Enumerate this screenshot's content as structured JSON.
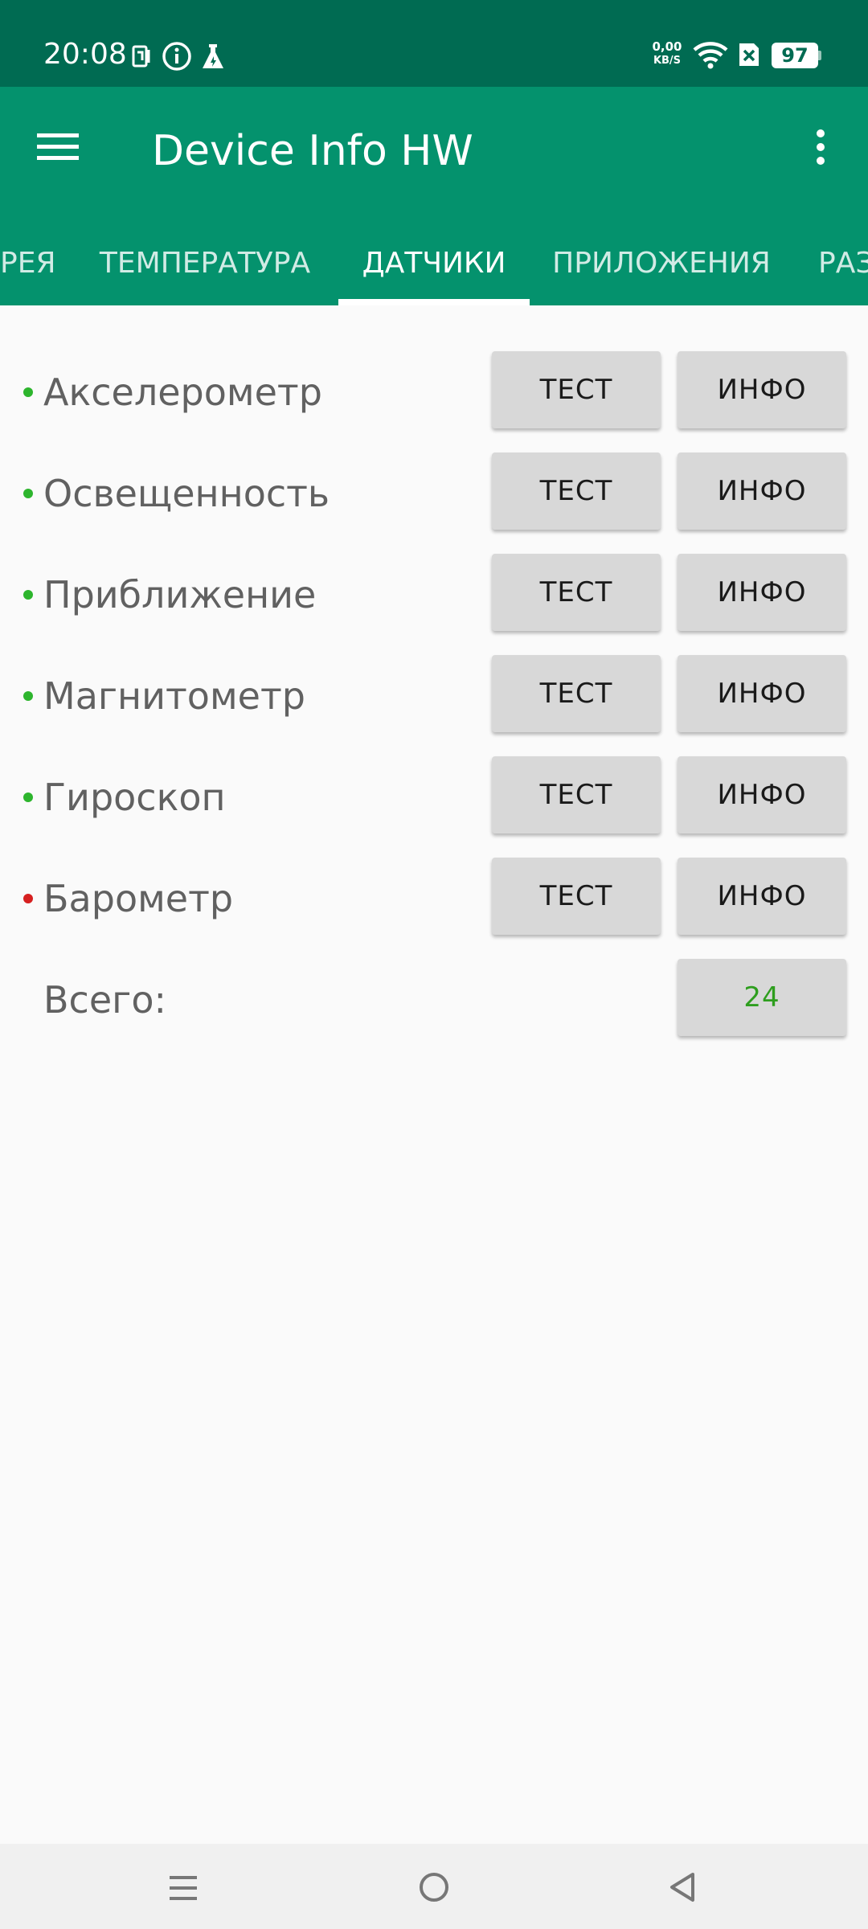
{
  "status_bar": {
    "time": "20:08",
    "net_speed_value": "0,00",
    "net_speed_unit": "KB/S",
    "battery": "97",
    "icons": [
      "nfc-icon",
      "info-icon",
      "flask-icon",
      "wifi-icon",
      "sim-off-icon",
      "battery-icon"
    ]
  },
  "app_bar": {
    "title": "Device Info HW",
    "menu_icon": "hamburger-menu-icon",
    "overflow_icon": "more-vertical-icon"
  },
  "tabs": [
    {
      "label": "РЕЯ"
    },
    {
      "label": "ТЕМПЕРАТУРА"
    },
    {
      "label": "ДАТЧИКИ",
      "active": true
    },
    {
      "label": "ПРИЛОЖЕНИЯ"
    },
    {
      "label": "РАЗ"
    }
  ],
  "sensors": [
    {
      "name": "Акселерометр",
      "status_color": "#2db52d",
      "test_label": "ТЕСТ",
      "info_label": "ИНФО"
    },
    {
      "name": "Освещенность",
      "status_color": "#2db52d",
      "test_label": "ТЕСТ",
      "info_label": "ИНФО"
    },
    {
      "name": "Приближение",
      "status_color": "#2db52d",
      "test_label": "ТЕСТ",
      "info_label": "ИНФО"
    },
    {
      "name": "Магнитометр",
      "status_color": "#2db52d",
      "test_label": "ТЕСТ",
      "info_label": "ИНФО"
    },
    {
      "name": "Гироскоп",
      "status_color": "#2db52d",
      "test_label": "ТЕСТ",
      "info_label": "ИНФО"
    },
    {
      "name": "Барометр",
      "status_color": "#d62020",
      "test_label": "ТЕСТ",
      "info_label": "ИНФО"
    }
  ],
  "total": {
    "label": "Всего:",
    "value": "24",
    "value_color": "#2e9e1e"
  },
  "nav_bar": {
    "icons": [
      "recents-icon",
      "home-icon",
      "back-icon"
    ]
  },
  "colors": {
    "status_bar": "#006b52",
    "app_bar": "#04926d",
    "background": "#fafafa",
    "button": "#d8d8d8"
  }
}
